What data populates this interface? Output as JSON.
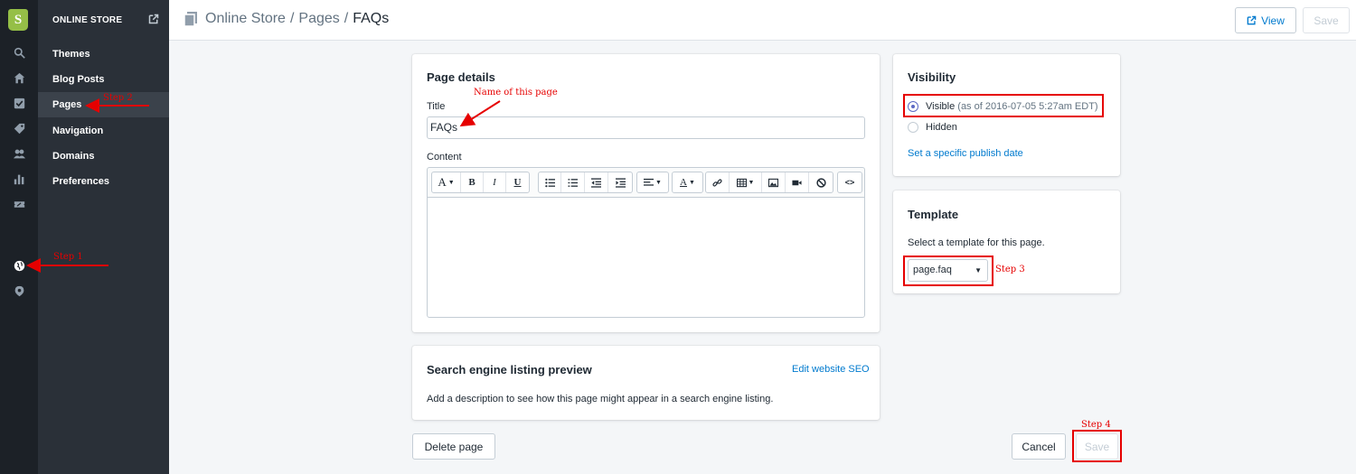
{
  "rail": {
    "logo_letter": "S",
    "icons": [
      "search-icon",
      "home-icon",
      "orders-icon",
      "tag-icon",
      "customers-icon",
      "analytics-icon",
      "discounts-icon",
      "online-store-icon",
      "location-icon"
    ]
  },
  "subnav": {
    "heading": "ONLINE STORE",
    "items": [
      {
        "label": "Themes"
      },
      {
        "label": "Blog Posts"
      },
      {
        "label": "Pages"
      },
      {
        "label": "Navigation"
      },
      {
        "label": "Domains"
      },
      {
        "label": "Preferences"
      }
    ]
  },
  "topbar": {
    "breadcrumb": [
      "Online Store",
      "Pages",
      "FAQs"
    ],
    "separator": "/",
    "view_label": "View",
    "save_label": "Save"
  },
  "page_details": {
    "heading": "Page details",
    "title_label": "Title",
    "title_value": "FAQs",
    "content_label": "Content",
    "toolbar": {
      "font": "A",
      "bold": "B",
      "italic": "I",
      "underline": "U",
      "color": "A",
      "html": "<>"
    }
  },
  "seo": {
    "heading": "Search engine listing preview",
    "edit_link": "Edit website SEO",
    "description": "Add a description to see how this page might appear in a search engine listing."
  },
  "visibility": {
    "heading": "Visibility",
    "visible_label": "Visible",
    "visible_note": "(as of 2016-07-05 5:27am EDT)",
    "hidden_label": "Hidden",
    "publish_link": "Set a specific publish date",
    "selected": "Visible"
  },
  "template": {
    "heading": "Template",
    "help": "Select a template for this page.",
    "selected": "page.faq"
  },
  "footer": {
    "delete_label": "Delete page",
    "cancel_label": "Cancel",
    "save_label": "Save"
  },
  "annotations": {
    "step1": "Step 1",
    "step2": "Step 2",
    "step3": "Step 3",
    "step4": "Step 4",
    "name_note": "Name of this page"
  },
  "colors": {
    "accent_link": "#007ace",
    "annotation_red": "#e60000",
    "rail_bg": "#1c2127",
    "subnav_bg": "#2a3038",
    "logo_green": "#95bf47"
  }
}
